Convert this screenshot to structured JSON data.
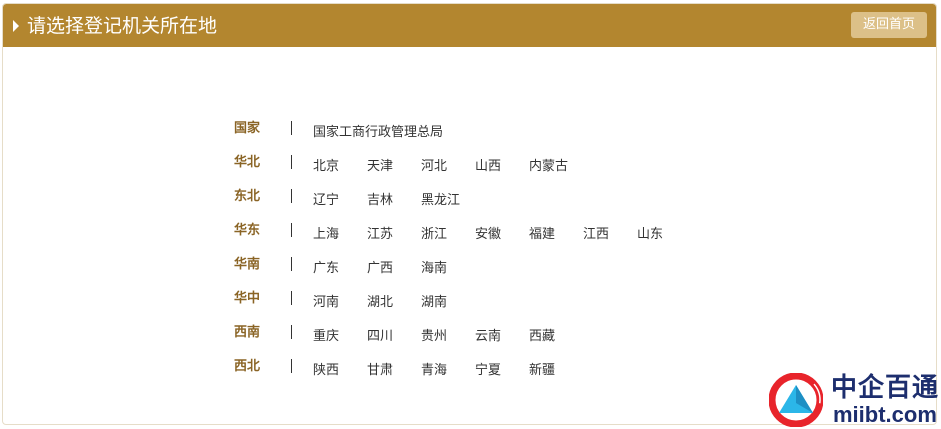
{
  "header": {
    "title": "请选择登记机关所在地",
    "back_label": "返回首页"
  },
  "regions": [
    {
      "name": "国家",
      "items": [
        "国家工商行政管理总局"
      ]
    },
    {
      "name": "华北",
      "items": [
        "北京",
        "天津",
        "河北",
        "山西",
        "内蒙古"
      ]
    },
    {
      "name": "东北",
      "items": [
        "辽宁",
        "吉林",
        "黑龙江"
      ]
    },
    {
      "name": "华东",
      "items": [
        "上海",
        "江苏",
        "浙江",
        "安徽",
        "福建",
        "江西",
        "山东"
      ]
    },
    {
      "name": "华南",
      "items": [
        "广东",
        "广西",
        "海南"
      ]
    },
    {
      "name": "华中",
      "items": [
        "河南",
        "湖北",
        "湖南"
      ]
    },
    {
      "name": "西南",
      "items": [
        "重庆",
        "四川",
        "贵州",
        "云南",
        "西藏"
      ]
    },
    {
      "name": "西北",
      "items": [
        "陕西",
        "甘肃",
        "青海",
        "宁夏",
        "新疆"
      ]
    }
  ],
  "watermark": {
    "cn": "中企百通",
    "en": "miibt.com"
  },
  "colors": {
    "header_bg": "#b3862f",
    "button_bg": "#dcc088",
    "region_name": "#8a6425"
  }
}
